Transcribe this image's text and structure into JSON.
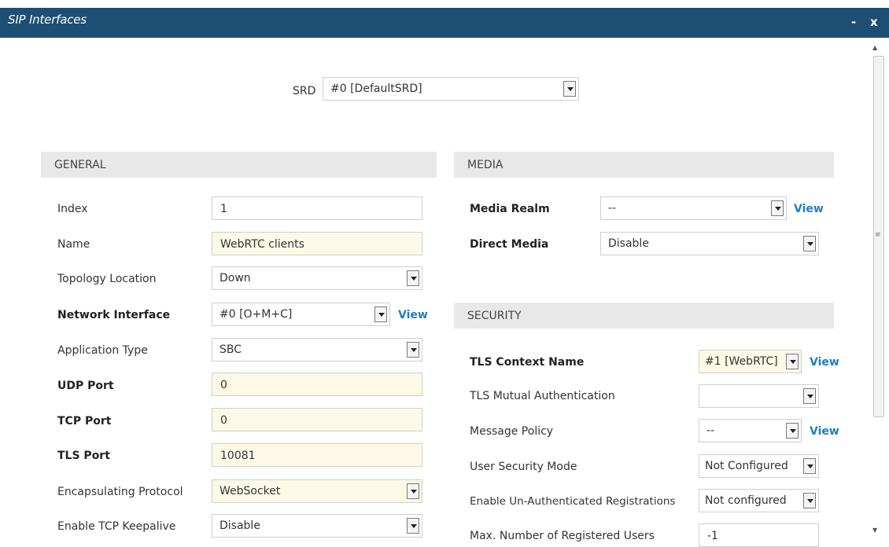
{
  "window": {
    "title": "SIP Interfaces",
    "minimize": "-",
    "close": "x"
  },
  "srd": {
    "label": "SRD",
    "value": "#0 [DefaultSRD]"
  },
  "general": {
    "heading": "GENERAL",
    "index": {
      "label": "Index",
      "value": "1"
    },
    "name": {
      "label": "Name",
      "value": "WebRTC clients"
    },
    "topology_location": {
      "label": "Topology Location",
      "value": "Down"
    },
    "network_interface": {
      "label": "Network Interface",
      "value": "#0 [O+M+C]",
      "link": "View"
    },
    "application_type": {
      "label": "Application Type",
      "value": "SBC"
    },
    "udp_port": {
      "label": "UDP Port",
      "value": "0"
    },
    "tcp_port": {
      "label": "TCP Port",
      "value": "0"
    },
    "tls_port": {
      "label": "TLS Port",
      "value": "10081"
    },
    "encapsulating_protocol": {
      "label": "Encapsulating Protocol",
      "value": "WebSocket"
    },
    "enable_tcp_keepalive": {
      "label": "Enable TCP Keepalive",
      "value": "Disable"
    }
  },
  "media": {
    "heading": "MEDIA",
    "media_realm": {
      "label": "Media Realm",
      "value": "--",
      "link": "View"
    },
    "direct_media": {
      "label": "Direct Media",
      "value": "Disable"
    }
  },
  "security": {
    "heading": "SECURITY",
    "tls_context_name": {
      "label": "TLS Context Name",
      "value": "#1 [WebRTC]",
      "link": "View"
    },
    "tls_mutual_auth": {
      "label": "TLS Mutual Authentication",
      "value": ""
    },
    "message_policy": {
      "label": "Message Policy",
      "value": "--",
      "link": "View"
    },
    "user_security_mode": {
      "label": "User Security Mode",
      "value": "Not Configured"
    },
    "unauth_registrations": {
      "label": "Enable Un-Authenticated Registrations",
      "value": "Not configured"
    },
    "max_registered_users": {
      "label": "Max. Number of Registered Users",
      "value": "-1"
    }
  }
}
